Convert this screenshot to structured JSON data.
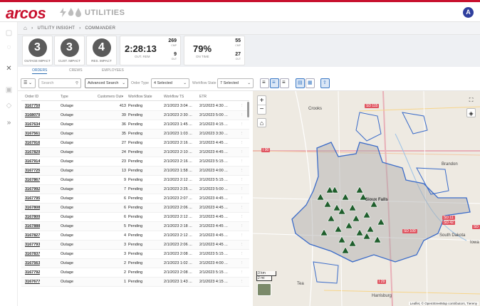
{
  "app": {
    "logo_text": "arcos",
    "product_name": "UTILITIES",
    "user_initial": "A"
  },
  "breadcrumb": [
    "UTILITY INSIGHT",
    "COMMANDER"
  ],
  "kpis": {
    "outage_impact": {
      "value": "3",
      "caption": "OUTAGE IMPACT"
    },
    "cust_impact": {
      "value": "3",
      "caption": "CUST. IMPACT"
    },
    "res_impact": {
      "value": "4",
      "caption": "RES. IMPACT"
    },
    "outage_timer": {
      "value": "2:28:13",
      "caption": "OUT. REM",
      "top_value": "269",
      "top_caption": "CMP",
      "bottom_value": "9",
      "bottom_caption": "OUT"
    },
    "on_time": {
      "value": "79%",
      "caption": "ON TIME",
      "top_value": "55",
      "top_caption": "CMP",
      "bottom_value": "27",
      "bottom_caption": "OUT"
    }
  },
  "tabs": [
    "ORDERS",
    "CREWS",
    "EMPLOYEES"
  ],
  "toolbar": {
    "search_placeholder": "Search",
    "advanced_search": "Advanced Search",
    "order_type_label": "Order Type",
    "order_type_value": "4 Selected",
    "workflow_state_label": "Workflow State",
    "workflow_state_value": "7 Selected"
  },
  "grid": {
    "columns": [
      "Order ID",
      "Type",
      "Customers Out",
      "Workflow State",
      "Workflow TS",
      "ETR"
    ],
    "rows": [
      {
        "id": "3167759",
        "type": "Outage",
        "cust": "413",
        "state": "Pending",
        "ts": "2/1/2023 3:04 ...",
        "etr": "2/1/2023 4:30 ..."
      },
      {
        "id": "3168079",
        "type": "Outage",
        "cust": "39",
        "state": "Pending",
        "ts": "2/1/2023 2:30 ...",
        "etr": "2/1/2023 5:00 ..."
      },
      {
        "id": "3167634",
        "type": "Outage",
        "cust": "36",
        "state": "Pending",
        "ts": "2/1/2023 1:45 ...",
        "etr": "2/1/2023 4:15 ..."
      },
      {
        "id": "3167561",
        "type": "Outage",
        "cust": "35",
        "state": "Pending",
        "ts": "2/1/2023 1:03 ...",
        "etr": "2/1/2023 3:30 ..."
      },
      {
        "id": "3167916",
        "type": "Outage",
        "cust": "27",
        "state": "Pending",
        "ts": "2/1/2023 2:16 ...",
        "etr": "2/1/2023 4:45 ..."
      },
      {
        "id": "3167829",
        "type": "Outage",
        "cust": "24",
        "state": "Pending",
        "ts": "2/1/2023 2:10 ...",
        "etr": "2/1/2023 4:45 ..."
      },
      {
        "id": "3167914",
        "type": "Outage",
        "cust": "23",
        "state": "Pending",
        "ts": "2/1/2023 2:16 ...",
        "etr": "2/1/2023 5:15 ..."
      },
      {
        "id": "3167725",
        "type": "Outage",
        "cust": "13",
        "state": "Pending",
        "ts": "2/1/2023 1:58 ...",
        "etr": "2/1/2023 4:00 ..."
      },
      {
        "id": "3167867",
        "type": "Outage",
        "cust": "9",
        "state": "Pending",
        "ts": "2/1/2023 2:12 ...",
        "etr": "2/1/2023 5:15 ..."
      },
      {
        "id": "3167992",
        "type": "Outage",
        "cust": "7",
        "state": "Pending",
        "ts": "2/1/2023 2:25 ...",
        "etr": "2/1/2023 5:00 ..."
      },
      {
        "id": "3167795",
        "type": "Outage",
        "cust": "6",
        "state": "Pending",
        "ts": "2/1/2023 2:07 ...",
        "etr": "2/1/2023 4:45 ..."
      },
      {
        "id": "3167808",
        "type": "Outage",
        "cust": "6",
        "state": "Pending",
        "ts": "2/1/2023 2:06 ...",
        "etr": "2/1/2023 4:45 ..."
      },
      {
        "id": "3167809",
        "type": "Outage",
        "cust": "6",
        "state": "Pending",
        "ts": "2/1/2023 2:12 ...",
        "etr": "2/1/2023 4:45 ..."
      },
      {
        "id": "3167888",
        "type": "Outage",
        "cust": "5",
        "state": "Pending",
        "ts": "2/1/2023 2:18 ...",
        "etr": "2/1/2023 4:45 ..."
      },
      {
        "id": "3167827",
        "type": "Outage",
        "cust": "4",
        "state": "Pending",
        "ts": "2/1/2023 2:12 ...",
        "etr": "2/1/2023 4:45 ..."
      },
      {
        "id": "3167793",
        "type": "Outage",
        "cust": "3",
        "state": "Pending",
        "ts": "2/1/2023 2:06 ...",
        "etr": "2/1/2023 4:45 ..."
      },
      {
        "id": "3167837",
        "type": "Outage",
        "cust": "3",
        "state": "Pending",
        "ts": "2/1/2023 2:08 ...",
        "etr": "2/1/2023 5:15 ..."
      },
      {
        "id": "3167563",
        "type": "Outage",
        "cust": "2",
        "state": "Pending",
        "ts": "2/1/2023 1:02 ...",
        "etr": "2/1/2023 4:00 ..."
      },
      {
        "id": "3167792",
        "type": "Outage",
        "cust": "2",
        "state": "Pending",
        "ts": "2/1/2023 2:08 ...",
        "etr": "2/1/2023 5:15 ..."
      },
      {
        "id": "3167677",
        "type": "Outage",
        "cust": "1",
        "state": "Pending",
        "ts": "2/1/2023 1:43 ...",
        "etr": "2/1/2023 4:15 ..."
      }
    ]
  },
  "map": {
    "labels": [
      "Crooks",
      "Brandon",
      "Tea",
      "Harrisburg",
      "South Dakota",
      "Iowa",
      "Sioux Falls"
    ],
    "shields": [
      "SD 115",
      "I 90",
      "I 29",
      "SD 11",
      "SD 42",
      "SD 100",
      "SD"
    ],
    "scale": [
      "3 km",
      "2 mi"
    ],
    "attribution": "Leaflet, © OpenStreetMap contributors, Tiereny"
  },
  "colors": {
    "brand": "#c8102e",
    "accent": "#2b6cb0",
    "marker": "#1f5e2c",
    "boundary": "#3a6bc9"
  }
}
